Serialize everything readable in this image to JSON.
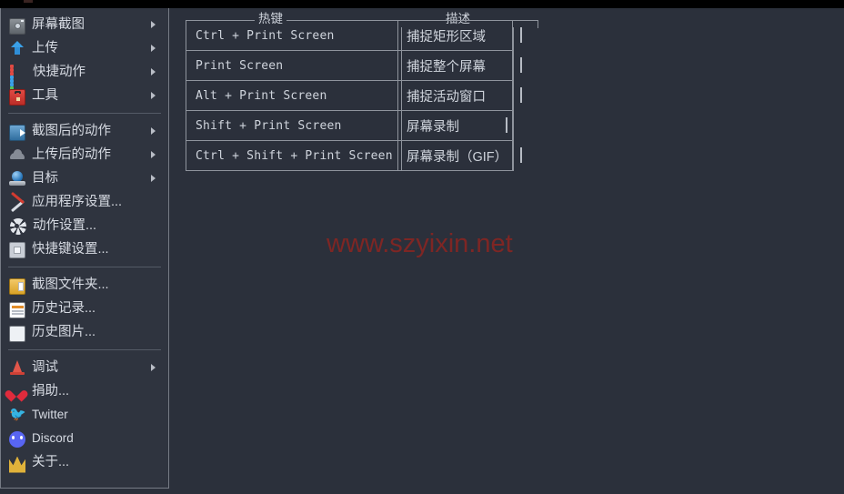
{
  "window": {
    "background_color": "#2b303b",
    "menu_background_color": "#2f343f",
    "border_color": "#767b85",
    "text_color": "#d6dae2"
  },
  "menu": {
    "groups": [
      {
        "items": [
          {
            "label": "屏幕截图",
            "icon": "camera-icon",
            "submenu": true
          },
          {
            "label": "上传",
            "icon": "upload-arrow-icon",
            "submenu": true
          },
          {
            "label": "快捷动作",
            "icon": "grid-dots-icon",
            "submenu": true
          },
          {
            "label": "工具",
            "icon": "toolbox-icon",
            "submenu": true
          }
        ]
      },
      {
        "items": [
          {
            "label": "截图后的动作",
            "icon": "after-capture-icon",
            "submenu": true
          },
          {
            "label": "上传后的动作",
            "icon": "cloud-icon",
            "submenu": true
          },
          {
            "label": "目标",
            "icon": "destination-globe-icon",
            "submenu": true
          },
          {
            "label": "应用程序设置...",
            "icon": "tools-wrench-icon",
            "submenu": false
          },
          {
            "label": "动作设置...",
            "icon": "gear-icon",
            "submenu": false
          },
          {
            "label": "快捷键设置...",
            "icon": "hotkey-settings-icon",
            "submenu": false
          }
        ]
      },
      {
        "items": [
          {
            "label": "截图文件夹...",
            "icon": "folder-icon",
            "submenu": false
          },
          {
            "label": "历史记录...",
            "icon": "history-list-icon",
            "submenu": false
          },
          {
            "label": "历史图片...",
            "icon": "image-history-icon",
            "submenu": false
          }
        ]
      },
      {
        "items": [
          {
            "label": "调试",
            "icon": "debug-cone-icon",
            "submenu": true
          },
          {
            "label": "捐助...",
            "icon": "heart-icon",
            "submenu": false
          },
          {
            "label": "Twitter",
            "icon": "twitter-icon",
            "submenu": false,
            "latin": true
          },
          {
            "label": "Discord",
            "icon": "discord-icon",
            "submenu": false,
            "latin": true
          },
          {
            "label": "关于...",
            "icon": "crown-icon",
            "submenu": false
          }
        ]
      }
    ]
  },
  "hotkey_table": {
    "headers": {
      "hotkey": "热键",
      "description": "描述"
    },
    "rows": [
      {
        "hotkey": "Ctrl + Print Screen",
        "description": "捕捉矩形区域"
      },
      {
        "hotkey": "Print Screen",
        "description": "捕捉整个屏幕"
      },
      {
        "hotkey": "Alt + Print Screen",
        "description": "捕捉活动窗口"
      },
      {
        "hotkey": "Shift + Print Screen",
        "description": "屏幕录制"
      },
      {
        "hotkey": "Ctrl + Shift + Print Screen",
        "description": "屏幕录制（GIF）"
      }
    ]
  },
  "watermark": {
    "text": "www.szyixin.net",
    "color": "#7e2624"
  }
}
